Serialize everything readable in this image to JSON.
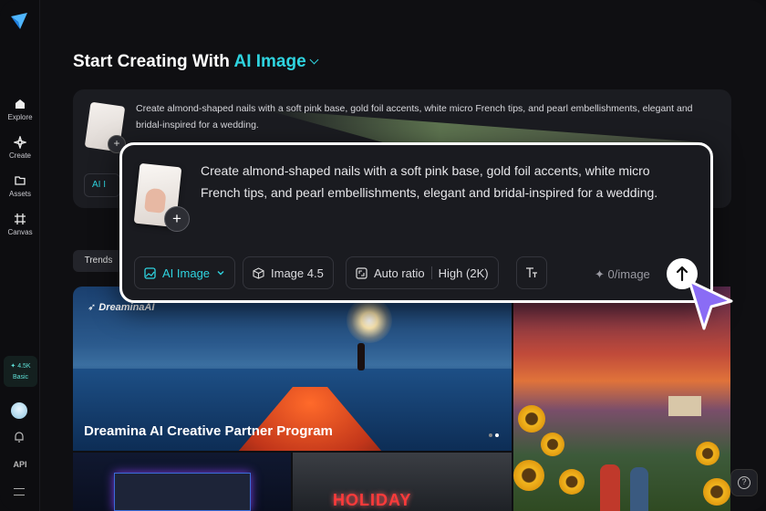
{
  "sidebar": {
    "items": [
      {
        "label": "Explore",
        "icon": "home-icon"
      },
      {
        "label": "Create",
        "icon": "sparkle-icon"
      },
      {
        "label": "Assets",
        "icon": "folder-icon"
      },
      {
        "label": "Canvas",
        "icon": "frame-icon"
      }
    ],
    "credits": "4.5K",
    "plan": "Basic",
    "api_label": "API"
  },
  "heading": {
    "prefix": "Start Creating With",
    "mode": "AI Image"
  },
  "prompt": {
    "text": "Create almond-shaped nails with a soft pink base, gold foil accents, white micro French tips, and pearl embellishments, elegant and bridal-inspired for a wedding.",
    "bg_mode_short": "AI I"
  },
  "toolbar": {
    "mode_label": "AI Image",
    "model_label": "Image 4.5",
    "ratio_label": "Auto ratio",
    "quality_label": "High (2K)",
    "cost_label": "0/image"
  },
  "gallery": {
    "tab_label": "Trends",
    "hero_brand": "DreaminaAI",
    "hero_title": "Dreamina AI Creative Partner Program",
    "tile4_text": "HOLIDAY"
  },
  "colors": {
    "accent": "#2fd4e0",
    "cursor": "#8a6cf5"
  }
}
